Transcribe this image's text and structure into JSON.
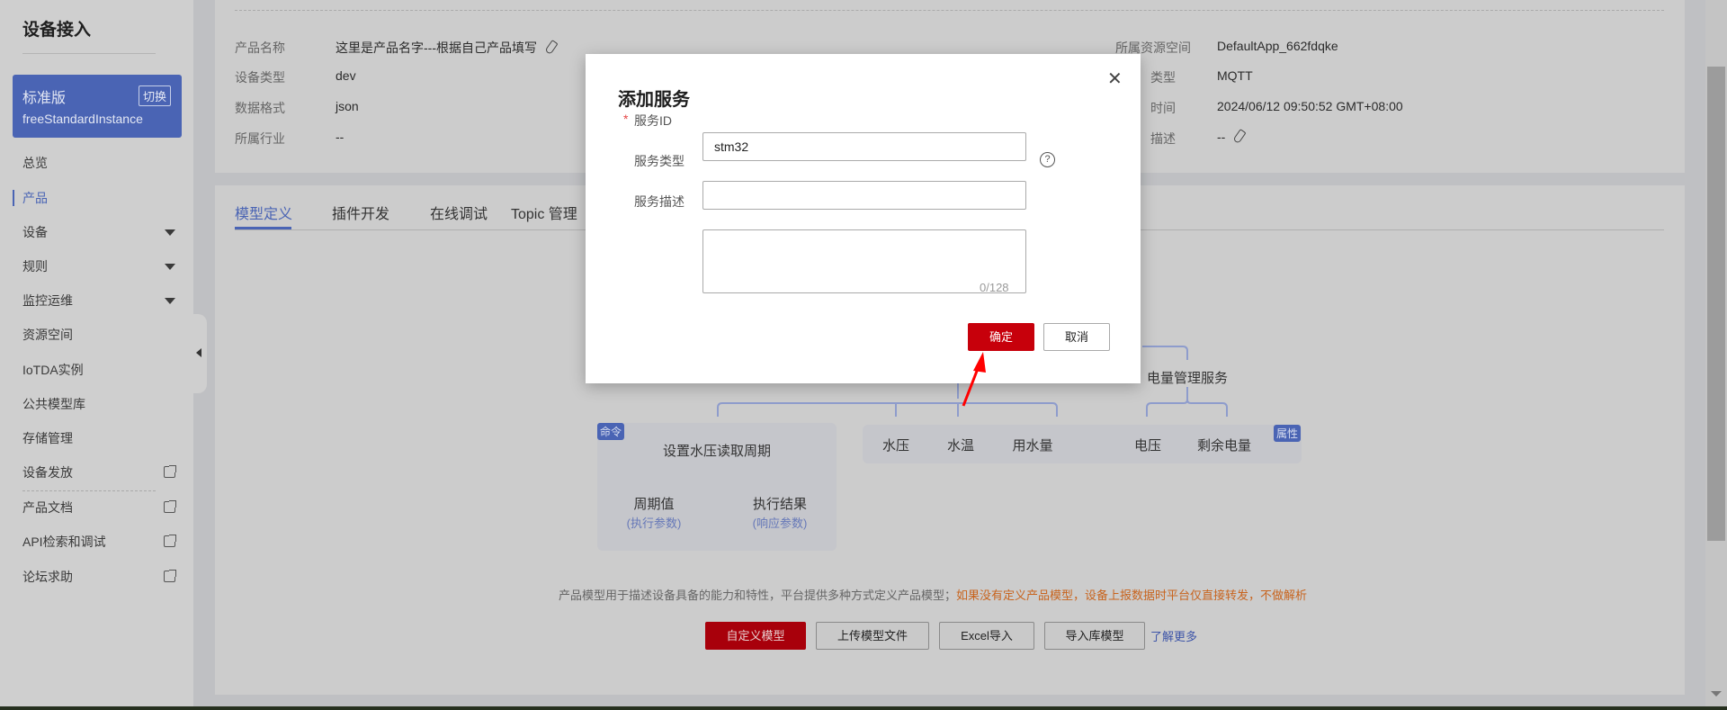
{
  "sidebar": {
    "title": "设备接入",
    "instance": {
      "edition": "标准版",
      "switch_label": "切换",
      "name": "freeStandardInstance"
    },
    "items": [
      {
        "label": "总览"
      },
      {
        "label": "产品",
        "active": true
      },
      {
        "label": "设备",
        "expandable": true
      },
      {
        "label": "规则",
        "expandable": true
      },
      {
        "label": "监控运维",
        "expandable": true
      },
      {
        "label": "资源空间"
      },
      {
        "label": "IoTDA实例"
      },
      {
        "label": "公共模型库"
      },
      {
        "label": "存储管理"
      },
      {
        "label": "设备发放",
        "external": true
      },
      {
        "label": "产品文档",
        "external": true
      },
      {
        "label": "API检索和调试",
        "external": true
      },
      {
        "label": "论坛求助",
        "external": true
      }
    ]
  },
  "product_info": {
    "left": [
      {
        "label": "产品名称",
        "value": "这里是产品名字---根据自己产品填写"
      },
      {
        "label": "设备类型",
        "value": "dev"
      },
      {
        "label": "数据格式",
        "value": "json"
      },
      {
        "label": "所属行业",
        "value": "--"
      }
    ],
    "right": [
      {
        "label": "所属资源空间",
        "value": "DefaultApp_662fdqke"
      },
      {
        "label": "类型",
        "value": "MQTT"
      },
      {
        "label": "时间",
        "value": "2024/06/12 09:50:52 GMT+08:00"
      },
      {
        "label": "描述",
        "value": "--"
      }
    ]
  },
  "tabs": [
    {
      "label": "模型定义",
      "active": true
    },
    {
      "label": "插件开发"
    },
    {
      "label": "在线调试"
    },
    {
      "label": "Topic 管理"
    }
  ],
  "diagram": {
    "service2": "电量管理服务",
    "command_badge": "命令",
    "property_badge": "属性",
    "command": {
      "name": "设置水压读取周期",
      "params": [
        {
          "name": "周期值",
          "sub": "(执行参数)"
        },
        {
          "name": "执行结果",
          "sub": "(响应参数)"
        }
      ]
    },
    "properties": [
      "水压",
      "水温",
      "用水量",
      "电压",
      "剩余电量"
    ]
  },
  "hint": {
    "normal": "产品模型用于描述设备具备的能力和特性，平台提供多种方式定义产品模型；",
    "warning": "如果没有定义产品模型，设备上报数据时平台仅直接转发，不做解析"
  },
  "actions": {
    "custom": "自定义模型",
    "upload": "上传模型文件",
    "excel": "Excel导入",
    "library": "导入库模型",
    "learn_more": "了解更多"
  },
  "modal": {
    "title": "添加服务",
    "fields": {
      "service_id": {
        "label": "服务ID",
        "value": "stm32",
        "required": true
      },
      "service_type": {
        "label": "服务类型",
        "value": ""
      },
      "service_desc": {
        "label": "服务描述",
        "value": "",
        "counter": "0/128"
      }
    },
    "confirm": "确定",
    "cancel": "取消"
  },
  "colors": {
    "accent": "#4a64b4",
    "primary_red": "#c7000b",
    "warning": "#c8641e",
    "annotation_arrow": "#ff0000"
  }
}
